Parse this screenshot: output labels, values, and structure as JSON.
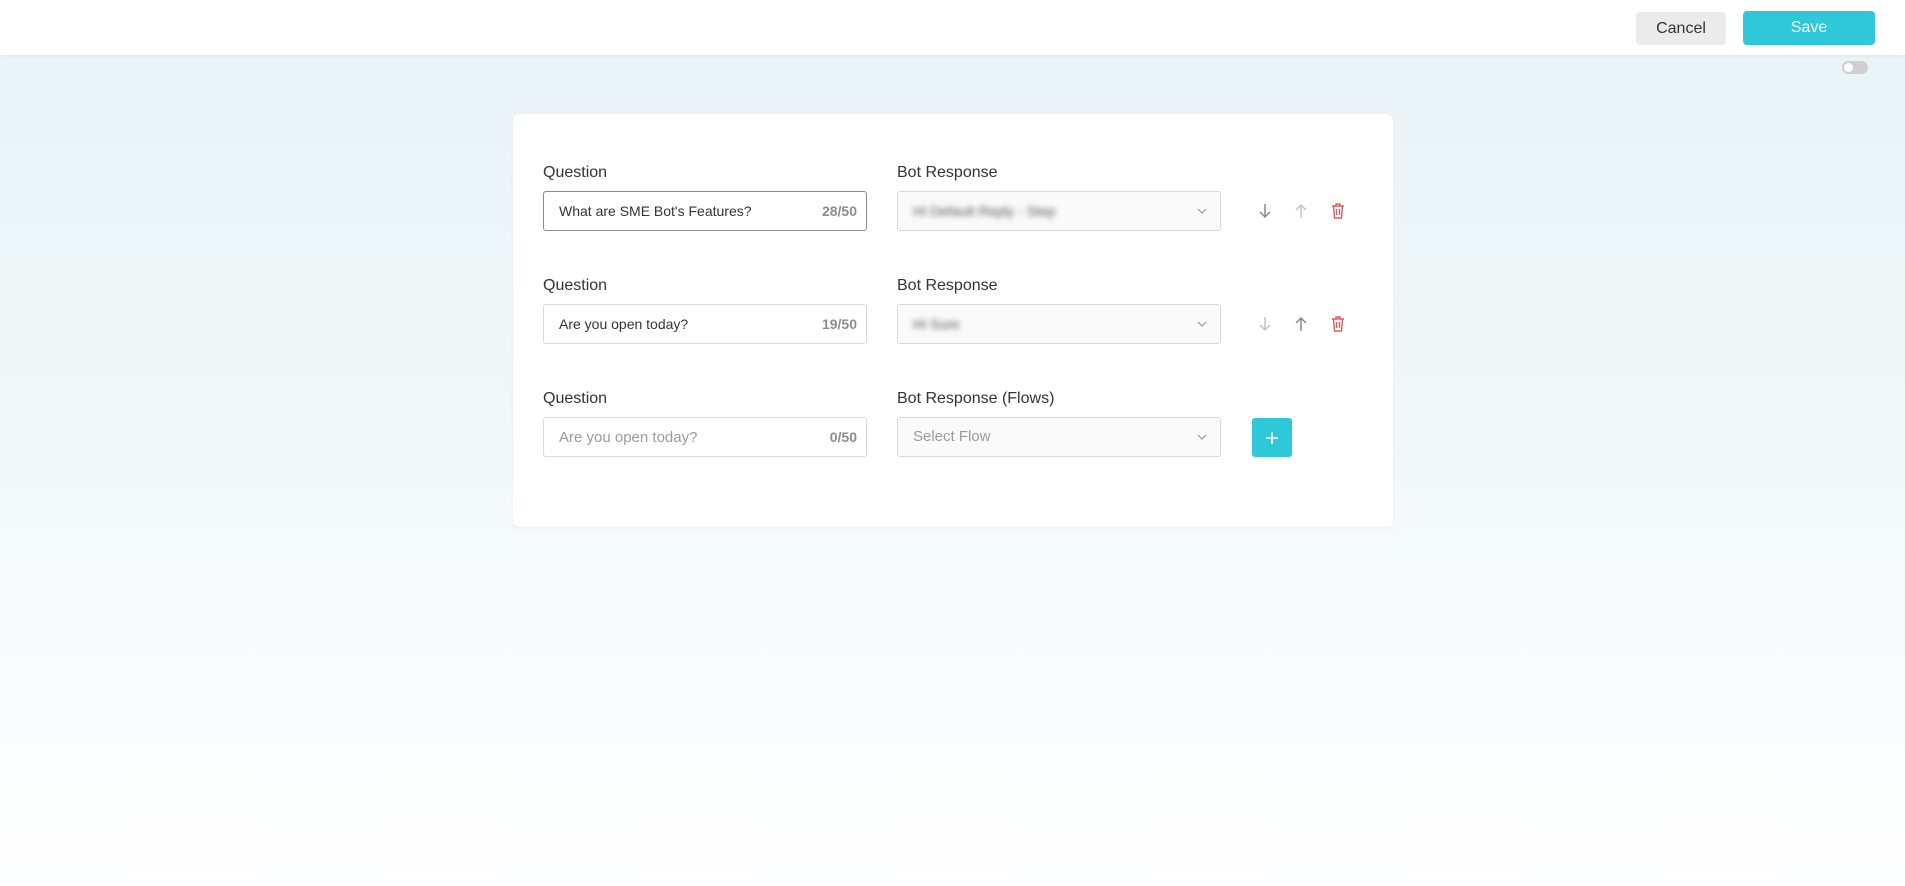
{
  "header": {
    "cancel_label": "Cancel",
    "save_label": "Save"
  },
  "colors": {
    "accent": "#2ec8d8",
    "delete": "#e05b63"
  },
  "rows": [
    {
      "question_label": "Question",
      "question_value": "What are SME Bot's Features?",
      "counter": "28/50",
      "response_label": "Bot Response",
      "response_value": "Hi Default Reply - Step"
    },
    {
      "question_label": "Question",
      "question_value": "Are you open today?",
      "counter": "19/50",
      "response_label": "Bot Response",
      "response_value": "Hi Sure"
    },
    {
      "question_label": "Question",
      "question_value": "",
      "question_placeholder": "Are you open today?",
      "counter": "0/50",
      "response_label": "Bot Response (Flows)",
      "response_placeholder": "Select Flow"
    }
  ],
  "icons": {
    "move_down": "arrow-down-icon",
    "move_up": "arrow-up-icon",
    "delete": "trash-icon",
    "add": "plus-icon",
    "dropdown": "chevron-down-icon"
  }
}
